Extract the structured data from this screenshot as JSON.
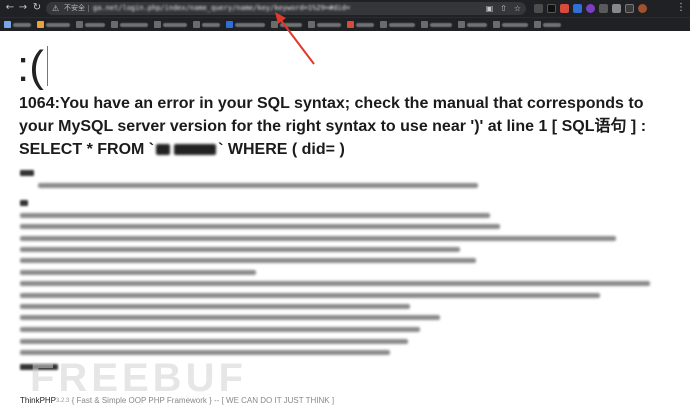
{
  "browser": {
    "insecure_label": "不安全",
    "url": "ga.net/login.php/index/name_query/name/key/keyword=1%29=#did=",
    "nav_back_icon": "arrow-left-icon",
    "nav_forward_icon": "arrow-right-icon",
    "reload_icon": "reload-icon",
    "menu_icon": "kebab-menu-icon"
  },
  "page": {
    "face": ":(",
    "error_line1": "1064:You have an error in your SQL syntax; check the manual that corresponds to",
    "error_line2": "your MySQL server version for the right syntax to use near ')' at line 1 [ SQL语句 ] :",
    "error_line3_before": "SELECT * FROM `",
    "error_line3_after": "` WHERE ( did= )"
  },
  "footer": {
    "brand": "ThinkPHP",
    "version": "3.2.3",
    "tagline": "{ Fast & Simple OOP PHP Framework } -- [ WE CAN DO IT JUST THINK ]"
  },
  "watermark": "FREEBUF",
  "colors": {
    "chrome_bg": "#202124",
    "omnibox_bg": "#35363a",
    "arrow": "#e0392b",
    "text": "#1b1b1b"
  }
}
